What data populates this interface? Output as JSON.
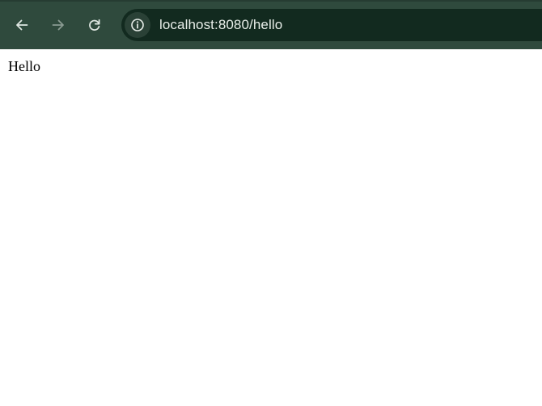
{
  "toolbar": {
    "back_icon": "arrow-left-icon",
    "forward_icon": "arrow-right-icon",
    "reload_icon": "reload-icon",
    "site_info_icon": "info-circle-icon"
  },
  "address_bar": {
    "url": "localhost:8080/hello"
  },
  "page": {
    "body_text": "Hello"
  },
  "colors": {
    "toolbar_bg": "#2f4a3d",
    "omnibox_bg": "#122a1f",
    "icon_active": "#dfe7e2",
    "icon_disabled": "#8a9b92"
  }
}
